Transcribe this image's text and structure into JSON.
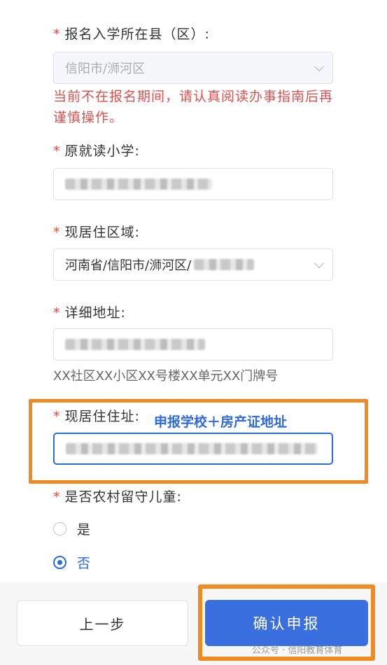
{
  "form": {
    "district": {
      "label": "报名入学所在县（区）:",
      "value": "信阳市/浉河区"
    },
    "warning": "当前不在报名期间，请认真阅读办事指南后再谨慎操作。",
    "school": {
      "label": "原就读小学:"
    },
    "region": {
      "label": "现居住区域:",
      "value": "河南省/信阳市/浉河区/"
    },
    "address": {
      "label": "详细地址:",
      "hint": "XX社区XX小区XX号楼XX单元XX门牌号"
    },
    "residence": {
      "label": "现居住住址:",
      "annotation": "申报学校＋房产证地址"
    },
    "left_behind": {
      "label": "是否农村留守儿童:",
      "options": [
        {
          "label": "是",
          "checked": false
        },
        {
          "label": "否",
          "checked": true
        }
      ]
    }
  },
  "buttons": {
    "prev": "上一步",
    "submit": "确认申报"
  },
  "watermark": "公众号 · 信阳教育体育",
  "colors": {
    "accent": "#3a6fe0",
    "warning": "#d9534f",
    "highlight": "#f28a22",
    "required": "#e5483c"
  }
}
